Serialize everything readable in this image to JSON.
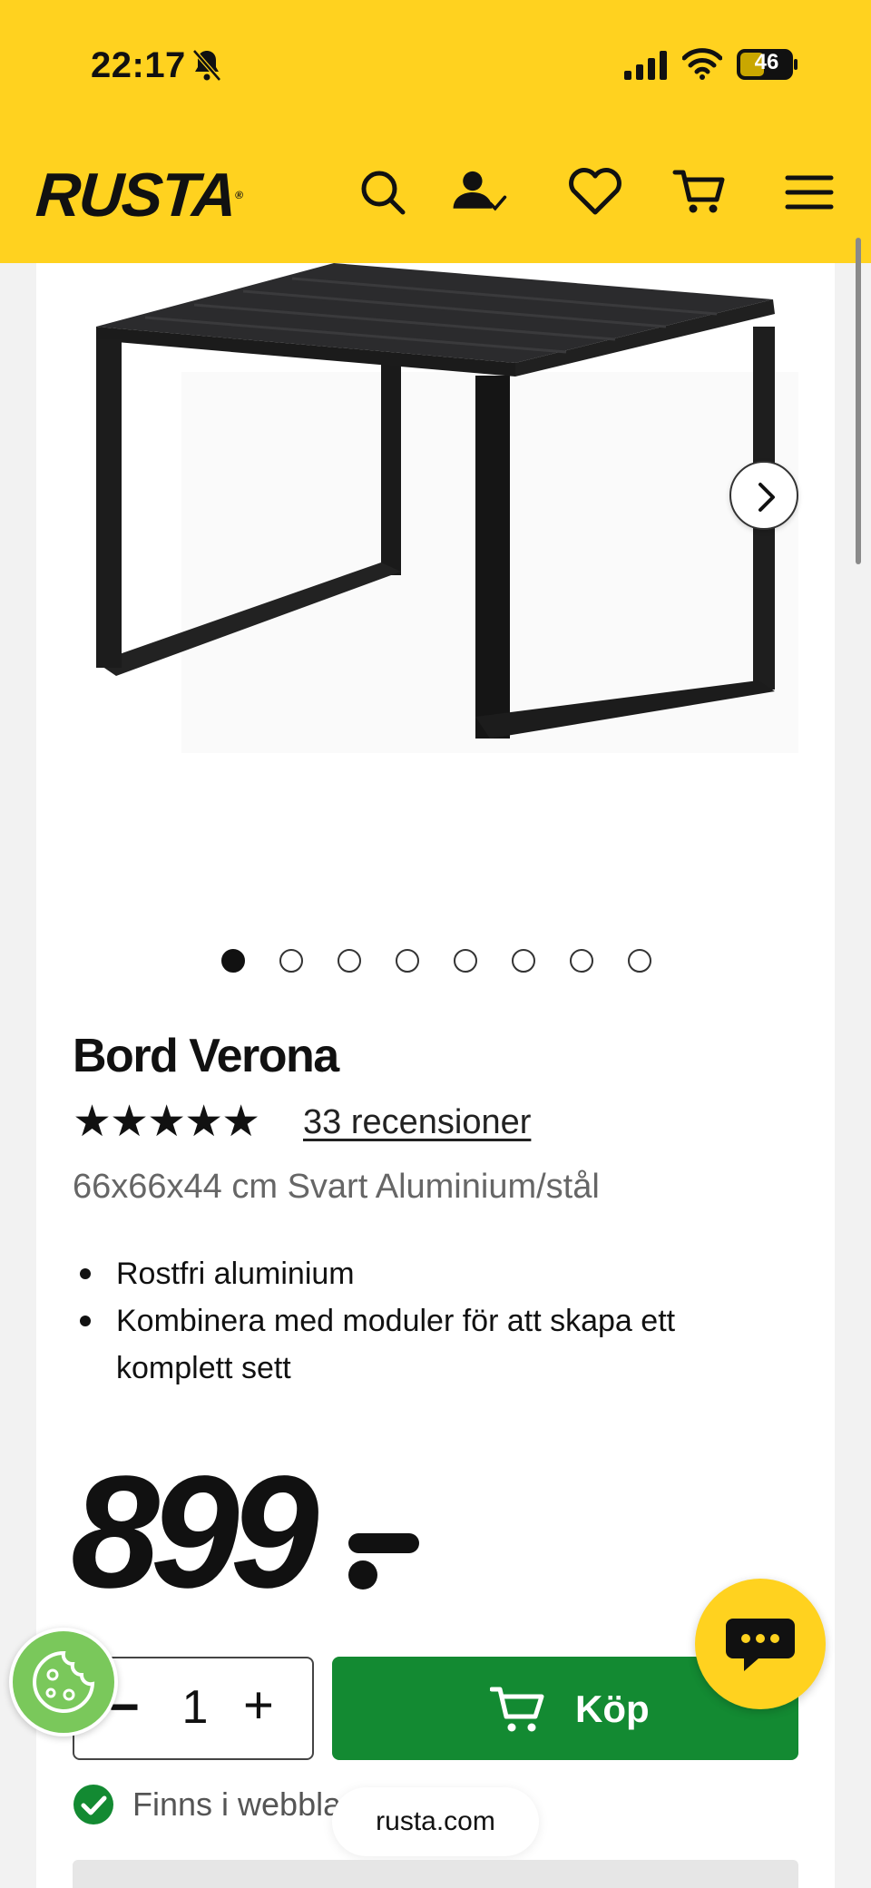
{
  "status_bar": {
    "time": "22:17",
    "battery": "46"
  },
  "header": {
    "logo": "RUSTA",
    "logo_mark": "®"
  },
  "gallery": {
    "image_count": 8,
    "active_index": 0
  },
  "product": {
    "title": "Bord Verona",
    "rating_stars": "★★★★★",
    "rating": 5,
    "reviews_label": "33 recensioner",
    "subtitle": "66x66x44 cm Svart Aluminium/stål",
    "features": [
      "Rostfri aluminium",
      "Kombinera med moduler för att skapa ett komplett sett"
    ],
    "price": "899"
  },
  "purchase": {
    "qty_minus": "−",
    "quantity": "1",
    "qty_plus": "+",
    "buy_label": "Köp"
  },
  "availability": {
    "text": "Finns i webblager"
  },
  "browser": {
    "url": "rusta.com"
  },
  "colors": {
    "brand_yellow": "#ffd21f",
    "buy_green": "#138a32",
    "cookie_green": "#7ac85b",
    "stock_green": "#138a32"
  }
}
